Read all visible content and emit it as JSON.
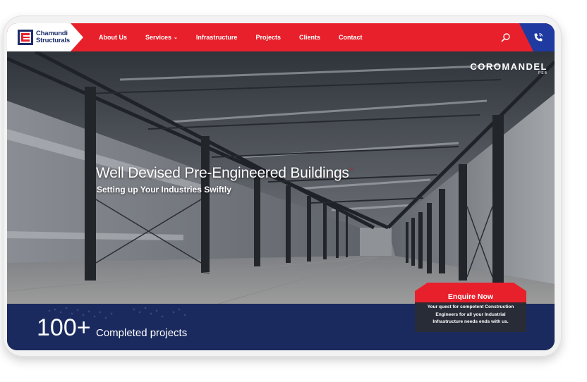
{
  "logo": {
    "line1": "Chamundi",
    "line2": "Structurals"
  },
  "nav": {
    "items": [
      {
        "label": "About Us"
      },
      {
        "label": "Services",
        "has_dropdown": true
      },
      {
        "label": "Infrastructure"
      },
      {
        "label": "Projects"
      },
      {
        "label": "Clients"
      },
      {
        "label": "Contact"
      }
    ],
    "dropdown_glyph": "⌄"
  },
  "brand": {
    "name": "COROMANDEL",
    "sub": "PEB"
  },
  "hero": {
    "title": "Well Devised Pre-Engineered Buildings",
    "subtitle": "Setting up Your Industries Swiftly"
  },
  "stats": {
    "number": "100+",
    "label": "Completed projects"
  },
  "enquire": {
    "title": "Enquire Now",
    "text": "Your quest for competent Construction Engineers for all your Industrial Infrastructure needs ends with us."
  },
  "colors": {
    "primary_red": "#e8202b",
    "navy": "#1a2a5e",
    "phone_blue": "#1f3aa0"
  },
  "icons": {
    "search": "search-icon",
    "phone": "phone-icon"
  }
}
